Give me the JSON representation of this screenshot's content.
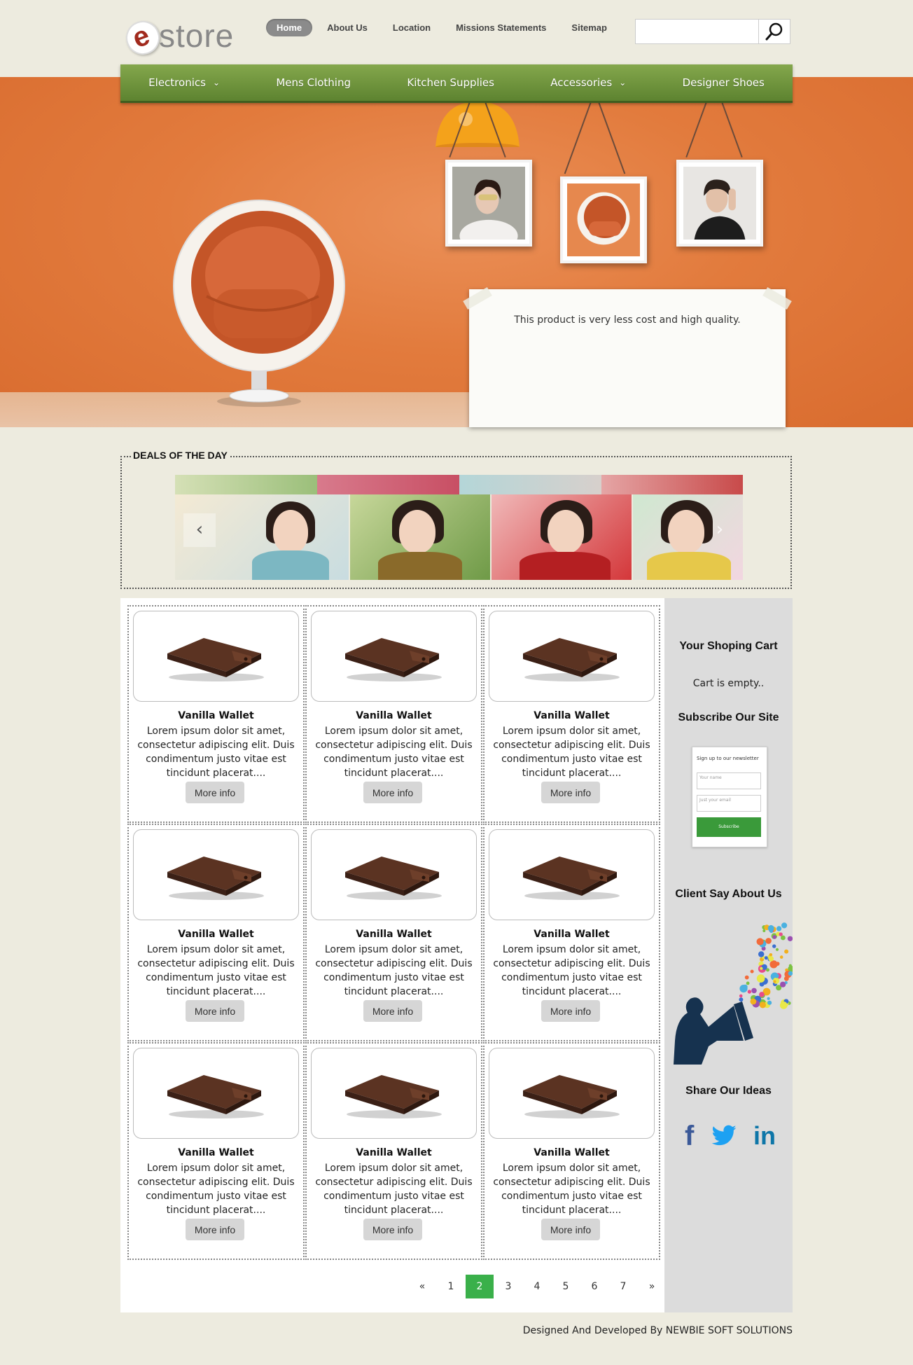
{
  "logo": {
    "letter": "e",
    "word": "store"
  },
  "top_nav": [
    {
      "label": "Home",
      "active": true
    },
    {
      "label": "About Us",
      "active": false
    },
    {
      "label": "Location",
      "active": false
    },
    {
      "label": "Missions Statements",
      "active": false
    },
    {
      "label": "Sitemap",
      "active": false
    }
  ],
  "search": {
    "value": "",
    "icon": "search-icon"
  },
  "main_nav": [
    {
      "label": "Electronics",
      "dropdown": true
    },
    {
      "label": "Mens Clothing",
      "dropdown": false
    },
    {
      "label": "Kitchen Supplies",
      "dropdown": false
    },
    {
      "label": "Accessories",
      "dropdown": true
    },
    {
      "label": "Designer Shoes",
      "dropdown": false
    }
  ],
  "hero": {
    "note_text": "This product is very less cost and high quality."
  },
  "deals": {
    "title": "DEALS OF THE DAY"
  },
  "products": [
    {
      "name": "Vanilla Wallet",
      "desc": "Lorem ipsum dolor sit amet, consectetur adipiscing elit. Duis condimentum justo vitae est tincidunt placerat....",
      "button": "More info"
    },
    {
      "name": "Vanilla Wallet",
      "desc": "Lorem ipsum dolor sit amet, consectetur adipiscing elit. Duis condimentum justo vitae est tincidunt placerat....",
      "button": "More info"
    },
    {
      "name": "Vanilla Wallet",
      "desc": "Lorem ipsum dolor sit amet, consectetur adipiscing elit. Duis condimentum justo vitae est tincidunt placerat....",
      "button": "More info"
    },
    {
      "name": "Vanilla Wallet",
      "desc": "Lorem ipsum dolor sit amet, consectetur adipiscing elit. Duis condimentum justo vitae est tincidunt placerat....",
      "button": "More info"
    },
    {
      "name": "Vanilla Wallet",
      "desc": "Lorem ipsum dolor sit amet, consectetur adipiscing elit. Duis condimentum justo vitae est tincidunt placerat....",
      "button": "More info"
    },
    {
      "name": "Vanilla Wallet",
      "desc": "Lorem ipsum dolor sit amet, consectetur adipiscing elit. Duis condimentum justo vitae est tincidunt placerat....",
      "button": "More info"
    },
    {
      "name": "Vanilla Wallet",
      "desc": "Lorem ipsum dolor sit amet, consectetur adipiscing elit. Duis condimentum justo vitae est tincidunt placerat....",
      "button": "More info"
    },
    {
      "name": "Vanilla Wallet",
      "desc": "Lorem ipsum dolor sit amet, consectetur adipiscing elit. Duis condimentum justo vitae est tincidunt placerat....",
      "button": "More info"
    },
    {
      "name": "Vanilla Wallet",
      "desc": "Lorem ipsum dolor sit amet, consectetur adipiscing elit. Duis condimentum justo vitae est tincidunt placerat....",
      "button": "More info"
    }
  ],
  "pagination": {
    "items": [
      "«",
      "1",
      "2",
      "3",
      "4",
      "5",
      "6",
      "7",
      "»"
    ],
    "active": "2"
  },
  "sidebar": {
    "cart_title": "Your Shoping Cart",
    "cart_status": "Cart is empty..",
    "subscribe_title": "Subscribe Our Site",
    "newsletter": {
      "heading": "Sign up to our newsletter",
      "name_placeholder": "Your name",
      "email_placeholder": "Just your email",
      "button": "Subscribe"
    },
    "client_title": "Client Say About Us",
    "share_title": "Share Our Ideas",
    "social": [
      {
        "icon": "facebook-icon",
        "glyph": "f",
        "color": "#3b5998"
      },
      {
        "icon": "twitter-icon",
        "glyph": "🐦",
        "color": "#1da1f2"
      },
      {
        "icon": "linkedin-icon",
        "glyph": "in",
        "color": "#0e76a8"
      }
    ]
  },
  "footer": {
    "credit": "Designed And Developed By NEWBIE SOFT SOLUTIONS"
  },
  "colors": {
    "page_bg": "#edebdf",
    "nav_green": "#6d9139",
    "hero_orange": "#e27b3d",
    "pagination_active": "#3ab04a",
    "sidebar_bg": "#dcdcdc"
  }
}
